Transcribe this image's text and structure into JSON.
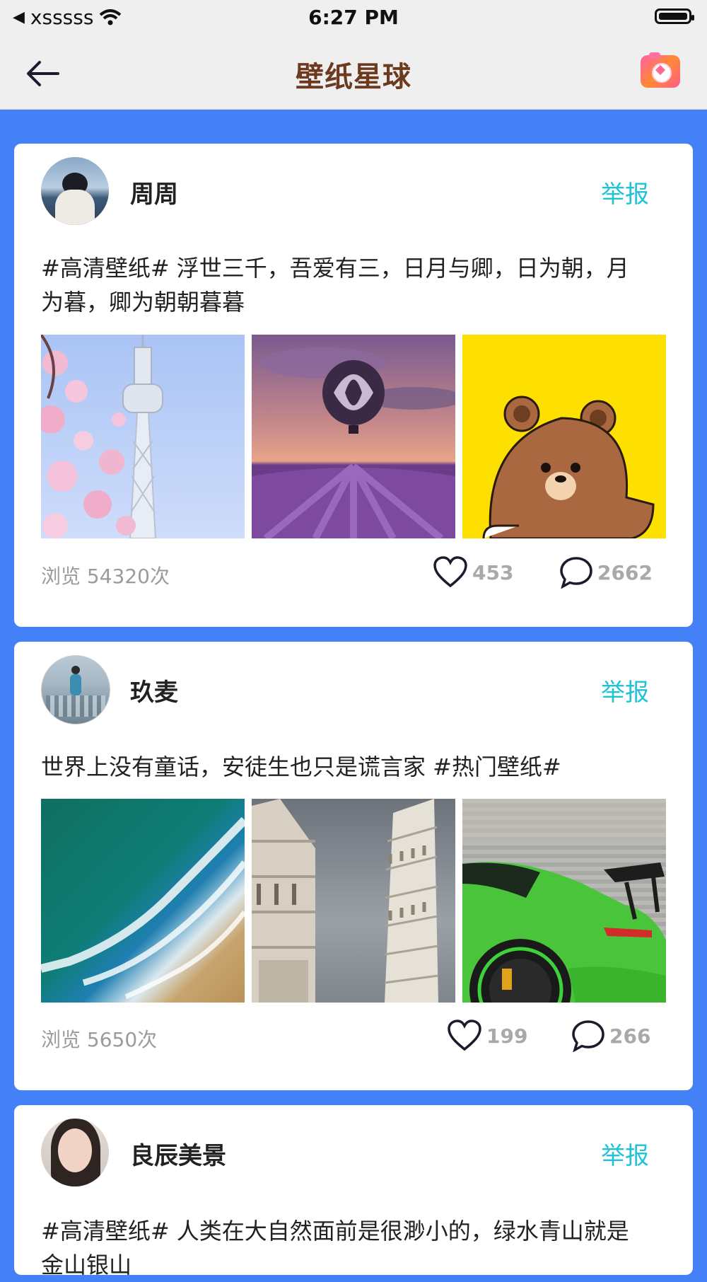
{
  "status_bar": {
    "carrier": "xsssss",
    "time": "6:27 PM"
  },
  "nav": {
    "title": "壁纸星球"
  },
  "colors": {
    "background": "#4481f7",
    "title": "#6b3a1f",
    "report": "#20c3d5",
    "muted": "#9b9b9b"
  },
  "posts": [
    {
      "username": "周周",
      "report_label": "举报",
      "text_line1": "#高清壁纸# 浮世三千，吾爱有三，日月与卿，日为朝，月",
      "text_line2": "为暮，卿为朝朝暮暮",
      "views": "浏览 54320次",
      "likes": "453",
      "comments": "2662",
      "images": [
        "tower-with-cherry-blossoms",
        "hot-air-balloon-over-lavender",
        "brown-bear-on-yellow"
      ]
    },
    {
      "username": "玖麦",
      "report_label": "举报",
      "text_line1": "世界上没有童话，安徒生也只是谎言家 #热门壁纸#",
      "views": "浏览 5650次",
      "likes": "199",
      "comments": "266",
      "images": [
        "ocean-waves-on-beach",
        "leaning-tower-of-pisa",
        "green-sports-car"
      ]
    },
    {
      "username": "良辰美景",
      "report_label": "举报",
      "text_line1": "#高清壁纸# 人类在大自然面前是很渺小的，绿水青山就是",
      "text_line2": "金山银山"
    }
  ]
}
